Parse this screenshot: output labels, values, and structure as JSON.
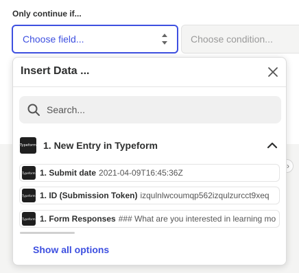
{
  "filter": {
    "label": "Only continue if...",
    "field_placeholder": "Choose field...",
    "condition_placeholder": "Choose condition..."
  },
  "dropdown": {
    "title": "Insert Data ...",
    "search_placeholder": "Search...",
    "group": {
      "title": "1. New Entry in Typeform",
      "app_logo_text": "Typeform"
    },
    "options": [
      {
        "name": "1. Submit date",
        "value": "2021-04-09T16:45:36Z"
      },
      {
        "name": "1. ID (Submission Token)",
        "value": "izqulnlwcoumqp562izqulzurcct9xeq"
      },
      {
        "name": "1. Form Responses",
        "value": "### What are you interested in learning mo"
      }
    ],
    "show_all_label": "Show all options"
  },
  "colors": {
    "accent": "#3d4fe0",
    "text": "#2d2e2e",
    "muted": "#9a9a9a"
  },
  "icons": {
    "updown": "chevron-updown-icon",
    "close": "close-icon",
    "search": "search-icon",
    "collapse": "chevron-up-icon"
  }
}
